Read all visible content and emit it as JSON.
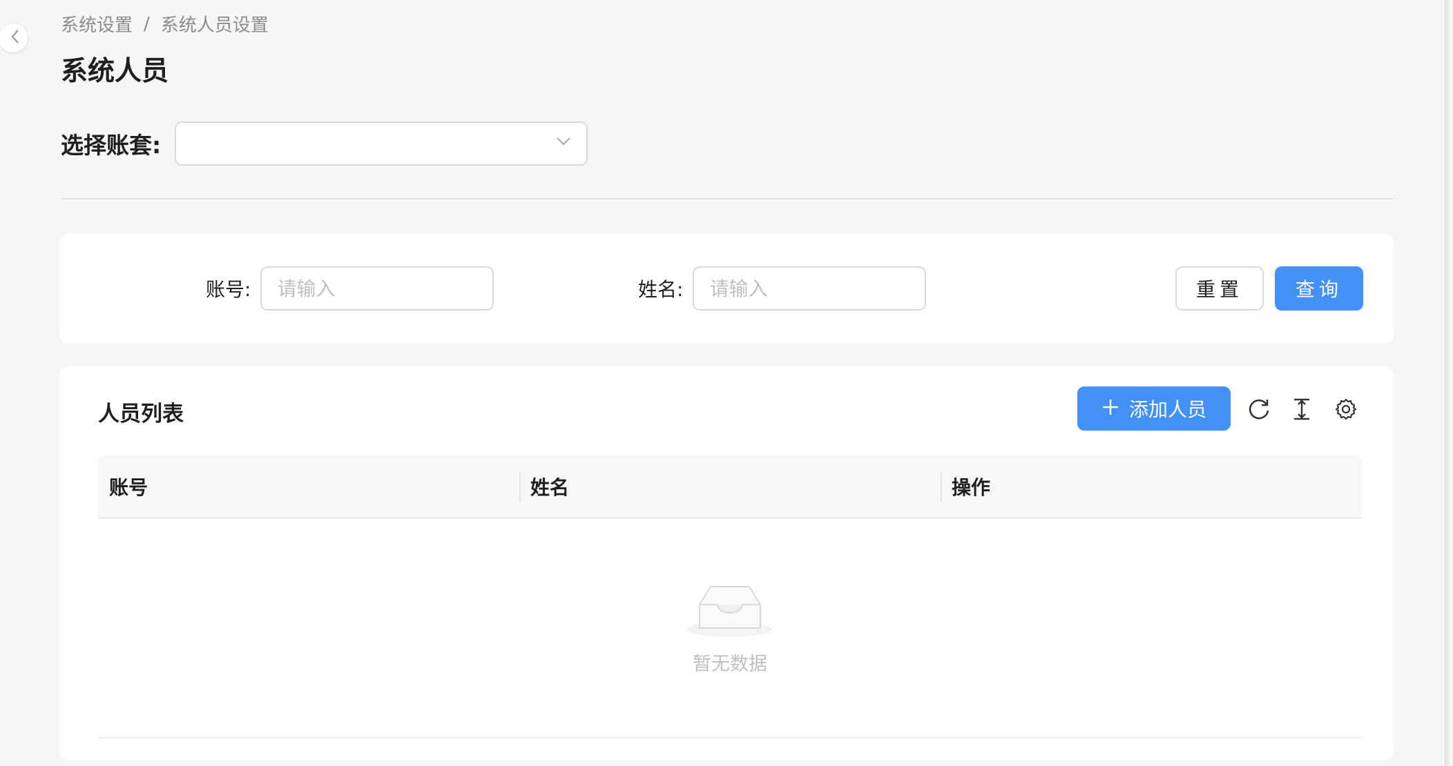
{
  "breadcrumb": {
    "items": [
      "系统设置",
      "系统人员设置"
    ],
    "separator": "/"
  },
  "page": {
    "title": "系统人员"
  },
  "account_select": {
    "label": "选择账套:",
    "value": ""
  },
  "search": {
    "account_label": "账号:",
    "account_placeholder": "请输入",
    "name_label": "姓名:",
    "name_placeholder": "请输入",
    "reset_label": "重置",
    "query_label": "查询"
  },
  "list": {
    "title": "人员列表",
    "add_label": "添加人员",
    "columns": [
      "账号",
      "姓名",
      "操作"
    ],
    "empty_text": "暂无数据"
  },
  "colors": {
    "primary": "#4390f7",
    "background": "#f6f6f6",
    "card": "#ffffff"
  },
  "icons": [
    "chevron-left-icon",
    "chevron-down-icon",
    "plus-icon",
    "reload-icon",
    "column-height-icon",
    "setting-icon",
    "empty-inbox-icon"
  ]
}
